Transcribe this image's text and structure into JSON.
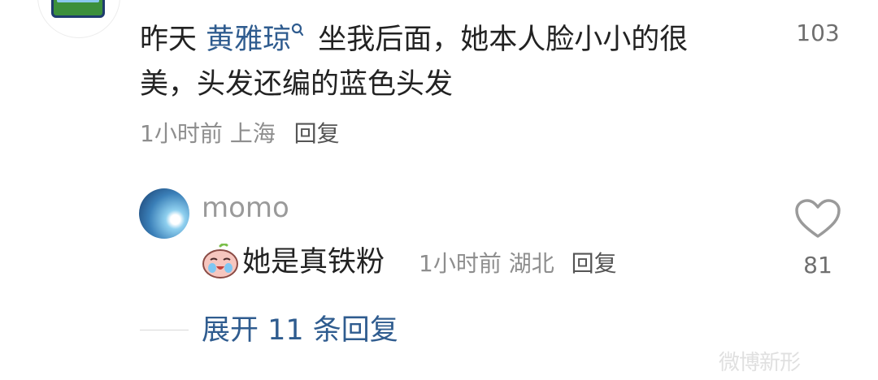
{
  "comment": {
    "text_before": "昨天 ",
    "mention": "黄雅琼",
    "text_after": " 坐我后面，她本人脸小小的很美，头发还编的蓝色头发",
    "time": "1小时前",
    "location": "上海",
    "reply_label": "回复",
    "like_count": "103"
  },
  "sub_comment": {
    "username": "momo",
    "emoji": "crying-face-emoji",
    "text": "她是真铁粉",
    "time": "1小时前",
    "location": "湖北",
    "reply_label": "回复",
    "like_count": "81"
  },
  "expand_label": "展开 11 条回复",
  "watermark": "微博新形"
}
